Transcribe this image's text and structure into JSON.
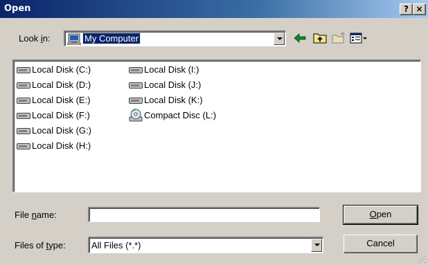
{
  "window": {
    "title": "Open",
    "help_label": "?",
    "close_label": "×"
  },
  "lookin": {
    "label_pre": "Look ",
    "label_key": "i",
    "label_post": "n:",
    "value": "My Computer"
  },
  "toolbar": {
    "icons": [
      "back-arrow-icon",
      "up-folder-icon",
      "new-folder-icon",
      "view-menu-icon"
    ]
  },
  "files": {
    "items": [
      {
        "label": "Local Disk (C:)",
        "icon": "drive-icon"
      },
      {
        "label": "Local Disk (D:)",
        "icon": "drive-icon"
      },
      {
        "label": "Local Disk (E:)",
        "icon": "drive-icon"
      },
      {
        "label": "Local Disk (F:)",
        "icon": "drive-icon"
      },
      {
        "label": "Local Disk (G:)",
        "icon": "drive-icon"
      },
      {
        "label": "Local Disk (H:)",
        "icon": "drive-icon"
      },
      {
        "label": "Local Disk (I:)",
        "icon": "drive-icon"
      },
      {
        "label": "Local Disk (J:)",
        "icon": "drive-icon"
      },
      {
        "label": "Local Disk (K:)",
        "icon": "drive-icon"
      },
      {
        "label": "Compact Disc (L:)",
        "icon": "cd-drive-icon"
      }
    ]
  },
  "filename": {
    "label_pre": "File ",
    "label_key": "n",
    "label_post": "ame:",
    "value": ""
  },
  "filetype": {
    "label_pre": "Files of ",
    "label_key": "t",
    "label_post": "ype:",
    "value": "All Files (*.*)"
  },
  "buttons": {
    "open_key": "O",
    "open_rest": "pen",
    "cancel": "Cancel"
  }
}
